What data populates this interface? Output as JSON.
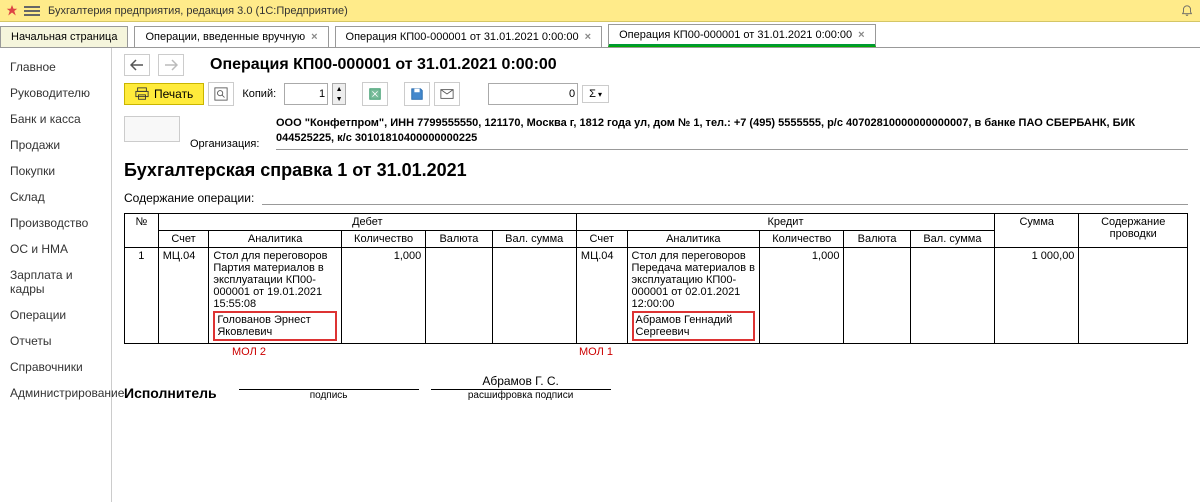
{
  "app_title": "Бухгалтерия предприятия, редакция 3.0  (1С:Предприятие)",
  "tabs": {
    "home": "Начальная страница",
    "t1": "Операции, введенные вручную",
    "t2": "Операция КП00-000001 от 31.01.2021 0:00:00",
    "t3": "Операция КП00-000001 от 31.01.2021 0:00:00"
  },
  "sidebar": {
    "items": [
      "Главное",
      "Руководителю",
      "Банк и касса",
      "Продажи",
      "Покупки",
      "Склад",
      "Производство",
      "ОС и НМА",
      "Зарплата и кадры",
      "Операции",
      "Отчеты",
      "Справочники",
      "Администрирование"
    ]
  },
  "header": {
    "title": "Операция КП00-000001 от 31.01.2021 0:00:00"
  },
  "toolbar": {
    "print": "Печать",
    "copies_label": "Копий:",
    "copies_value": "1",
    "sum_field": "0",
    "sigma": "Σ"
  },
  "org": {
    "label": "Организация:",
    "value": "ООО \"Конфетпром\", ИНН 7799555550, 121170, Москва г, 1812 года ул, дом № 1, тел.: +7 (495) 5555555, р/с 40702810000000000007, в банке ПАО СБЕРБАНК, БИК 044525225, к/с 30101810400000000225"
  },
  "doc_heading": "Бухгалтерская справка 1 от 31.01.2021",
  "content_label": "Содержание операции:",
  "table": {
    "headers": {
      "num": "№",
      "debit": "Дебет",
      "credit": "Кредит",
      "sum": "Сумма",
      "content": "Содержание проводки",
      "acct": "Счет",
      "analytics": "Аналитика",
      "qty": "Количество",
      "currency": "Валюта",
      "valsum": "Вал. сумма"
    },
    "row": {
      "n": "1",
      "d_acct": "МЦ.04",
      "d_analytics_main": "Стол для переговоров\nПартия материалов в эксплуатации КП00-000001 от 19.01.2021 15:55:08",
      "d_analytics_person": "Голованов Эрнест Яковлевич",
      "d_qty": "1,000",
      "c_acct": "МЦ.04",
      "c_analytics_main": "Стол для переговоров\nПередача материалов в эксплуатацию КП00-000001 от 02.01.2021 12:00:00",
      "c_analytics_person": "Абрамов Геннадий Сергеевич",
      "c_qty": "1,000",
      "sum": "1 000,00"
    },
    "mol1": "МОЛ 1",
    "mol2": "МОЛ 2"
  },
  "exec": {
    "title": "Исполнитель",
    "sign_cap": "подпись",
    "name": "Абрамов Г. С.",
    "name_cap": "расшифровка подписи"
  }
}
